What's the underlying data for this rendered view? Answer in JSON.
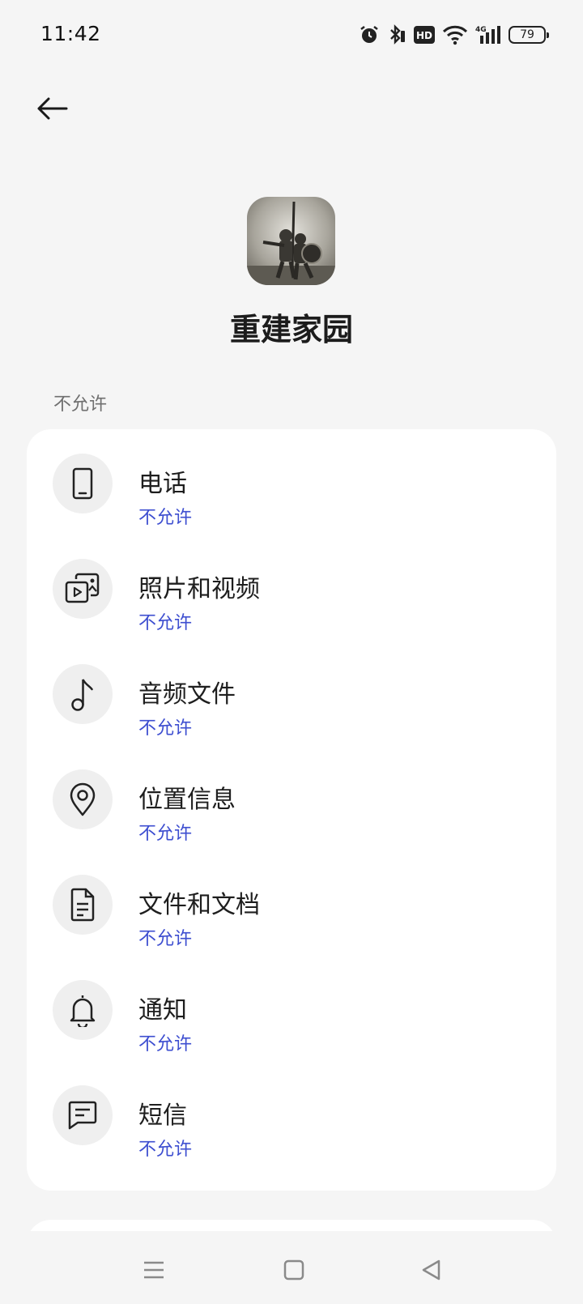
{
  "status_bar": {
    "time": "11:42",
    "network": "4G",
    "battery": "79",
    "icons": [
      "alarm-icon",
      "bluetooth-icon",
      "hd-icon",
      "wifi-icon",
      "signal-icon",
      "battery-icon"
    ]
  },
  "header": {
    "back_icon": "arrow-left-icon"
  },
  "app": {
    "name": "重建家园",
    "icon": "app-icon"
  },
  "section": {
    "title": "不允许"
  },
  "permissions": [
    {
      "label": "电话",
      "status": "不允许",
      "icon": "phone-icon"
    },
    {
      "label": "照片和视频",
      "status": "不允许",
      "icon": "photos-videos-icon"
    },
    {
      "label": "音频文件",
      "status": "不允许",
      "icon": "music-note-icon"
    },
    {
      "label": "位置信息",
      "status": "不允许",
      "icon": "location-pin-icon"
    },
    {
      "label": "文件和文档",
      "status": "不允许",
      "icon": "document-icon"
    },
    {
      "label": "通知",
      "status": "不允许",
      "icon": "bell-icon"
    },
    {
      "label": "短信",
      "status": "不允许",
      "icon": "message-icon"
    }
  ],
  "colors": {
    "background": "#f5f5f5",
    "card": "#ffffff",
    "status_blue": "#3d4ed0",
    "icon_bg": "#efefef"
  },
  "nav_bar": {
    "buttons": [
      "menu-icon",
      "home-icon",
      "back-triangle-icon"
    ]
  }
}
